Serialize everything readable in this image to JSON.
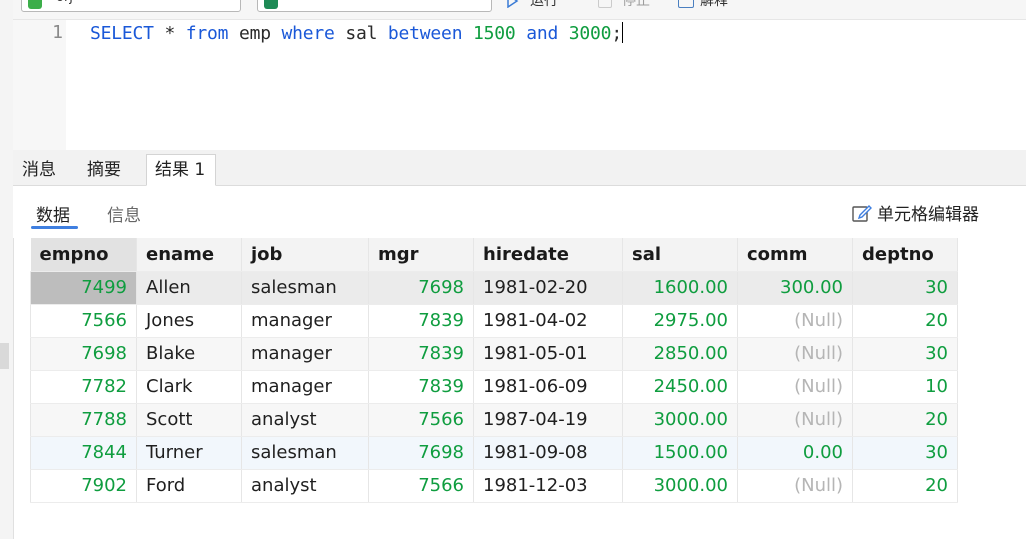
{
  "toolbar": {
    "connection_text": "orj",
    "database_text": "...",
    "run_label": "运行",
    "stop_label": "停止",
    "explain_label": "解释"
  },
  "editor": {
    "line_number": "1",
    "tokens": {
      "t1": "SELECT",
      "t2": " * ",
      "t3": "from",
      "t4": " emp ",
      "t5": "where",
      "t6": " sal ",
      "t7": "between",
      "t8": " ",
      "t9": "1500",
      "t10": " ",
      "t11": "and",
      "t12": " ",
      "t13": "3000",
      "t14": ";"
    }
  },
  "result_tabs": {
    "messages": "消息",
    "summary": "摘要",
    "result1": "结果 1"
  },
  "sub_tabs": {
    "data": "数据",
    "info": "信息"
  },
  "cell_editor_label": "单元格编辑器",
  "grid": {
    "columns": [
      "empno",
      "ename",
      "job",
      "mgr",
      "hiredate",
      "sal",
      "comm",
      "deptno"
    ],
    "rows": [
      [
        "7499",
        "Allen",
        "salesman",
        "7698",
        "1981-02-20",
        "1600.00",
        "300.00",
        "30"
      ],
      [
        "7566",
        "Jones",
        "manager",
        "7839",
        "1981-04-02",
        "2975.00",
        "(Null)",
        "20"
      ],
      [
        "7698",
        "Blake",
        "manager",
        "7839",
        "1981-05-01",
        "2850.00",
        "(Null)",
        "30"
      ],
      [
        "7782",
        "Clark",
        "manager",
        "7839",
        "1981-06-09",
        "2450.00",
        "(Null)",
        "10"
      ],
      [
        "7788",
        "Scott",
        "analyst",
        "7566",
        "1987-04-19",
        "3000.00",
        "(Null)",
        "20"
      ],
      [
        "7844",
        "Turner",
        "salesman",
        "7698",
        "1981-09-08",
        "1500.00",
        "0.00",
        "30"
      ],
      [
        "7902",
        "Ford",
        "analyst",
        "7566",
        "1981-12-03",
        "3000.00",
        "(Null)",
        "20"
      ]
    ]
  },
  "colors": {
    "keyword": "#1a58d8",
    "number": "#0f9d3f",
    "accent": "#3f7fe0",
    "null_text": "#b5b5b5"
  }
}
